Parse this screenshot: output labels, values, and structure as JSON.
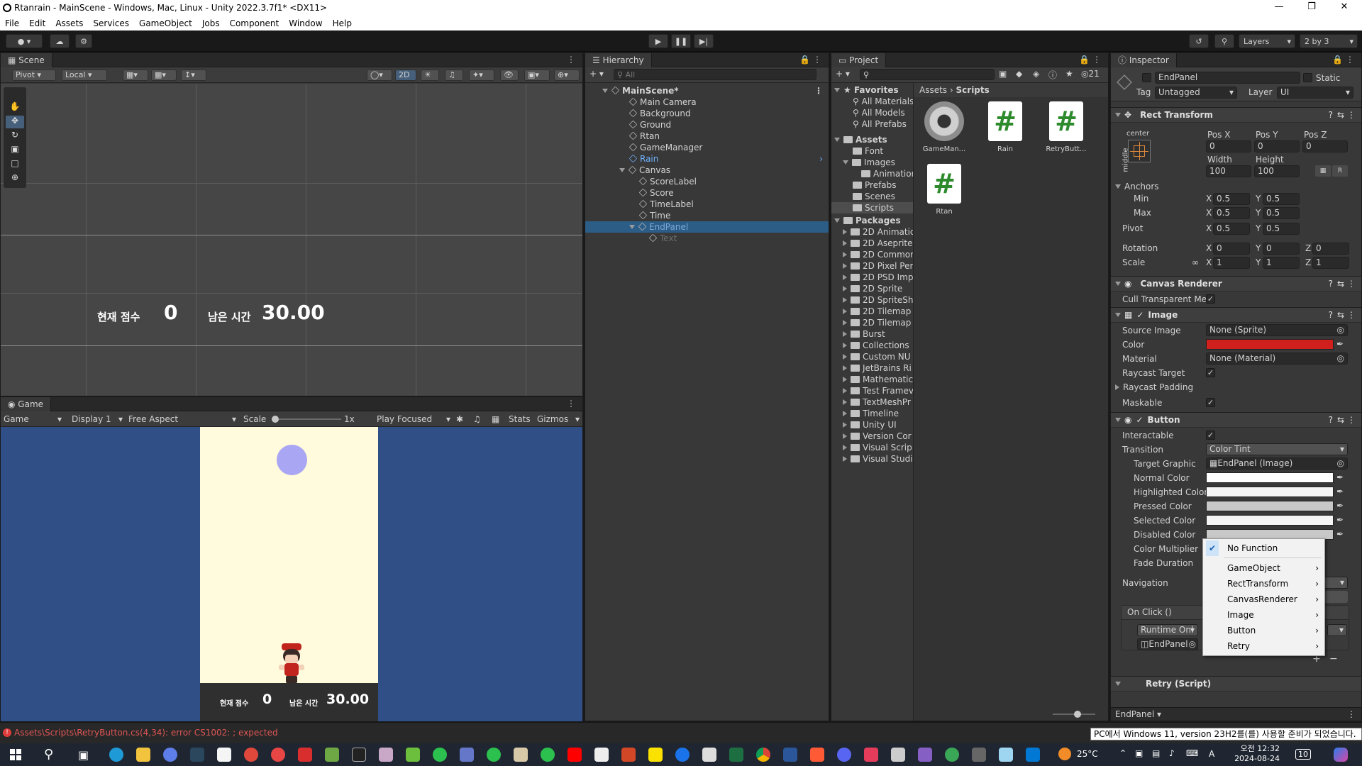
{
  "window": {
    "title": "Rtanrain - MainScene - Windows, Mac, Linux - Unity 2022.3.7f1* <DX11>"
  },
  "menu": [
    "File",
    "Edit",
    "Assets",
    "Services",
    "GameObject",
    "Jobs",
    "Component",
    "Window",
    "Help"
  ],
  "toolbar": {
    "layers_label": "Layers",
    "layout_label": "2 by 3"
  },
  "scene": {
    "tab": "Scene",
    "pivot": "Pivot",
    "local": "Local",
    "mode_2d": "2D",
    "score_label": "현재 점수",
    "score_value": "0",
    "time_label": "남은 시간",
    "time_value": "30.00"
  },
  "game": {
    "tab": "Game",
    "mode": "Game",
    "display": "Display 1",
    "aspect": "Free Aspect",
    "scale_label": "Scale",
    "scale_value": "1x",
    "play_focused": "Play Focused",
    "stats": "Stats",
    "gizmos": "Gizmos",
    "score_label": "현재 점수",
    "score_value": "0",
    "time_label": "남은 시간",
    "time_value": "30.00",
    "colors": {
      "background": "#2f4f86",
      "playfield": "#fffbdc",
      "rain": "#a9a6f4"
    }
  },
  "hierarchy": {
    "tab": "Hierarchy",
    "search_placeholder": "All",
    "items": [
      {
        "label": "MainScene*",
        "depth": 0
      },
      {
        "label": "Main Camera",
        "depth": 1
      },
      {
        "label": "Background",
        "depth": 1
      },
      {
        "label": "Ground",
        "depth": 1
      },
      {
        "label": "Rtan",
        "depth": 1
      },
      {
        "label": "GameManager",
        "depth": 1
      },
      {
        "label": "Rain",
        "depth": 1
      },
      {
        "label": "Canvas",
        "depth": 1
      },
      {
        "label": "ScoreLabel",
        "depth": 2
      },
      {
        "label": "Score",
        "depth": 2
      },
      {
        "label": "TimeLabel",
        "depth": 2
      },
      {
        "label": "Time",
        "depth": 2
      },
      {
        "label": "EndPanel",
        "depth": 2
      },
      {
        "label": "Text",
        "depth": 3
      }
    ]
  },
  "project": {
    "tab": "Project",
    "count": "21",
    "breadcrumb": [
      "Assets",
      "Scripts"
    ],
    "favorites_title": "Favorites",
    "favorites": [
      "All Materials",
      "All Models",
      "All Prefabs"
    ],
    "assets_title": "Assets",
    "assets": [
      "Font",
      "Images",
      "Animation",
      "Prefabs",
      "Scenes",
      "Scripts"
    ],
    "packages_title": "Packages",
    "packages": [
      "2D Animatic",
      "2D Aseprite",
      "2D Commor",
      "2D Pixel Per",
      "2D PSD Imp",
      "2D Sprite",
      "2D SpriteSh",
      "2D Tilemap",
      "2D Tilemap",
      "Burst",
      "Collections",
      "Custom NU",
      "JetBrains Ri",
      "Mathematic",
      "Test Framev",
      "TextMeshPr",
      "Timeline",
      "Unity UI",
      "Version Cor",
      "Visual Scrip",
      "Visual Studi"
    ],
    "files": [
      "GameMan...",
      "Rain",
      "RetryButt...",
      "Rtan"
    ]
  },
  "inspector": {
    "tab": "Inspector",
    "object_name": "EndPanel",
    "static_label": "Static",
    "tag_label": "Tag",
    "tag_value": "Untagged",
    "layer_label": "Layer",
    "layer_value": "UI",
    "rect_transform": {
      "title": "Rect Transform",
      "anchor_h": "center",
      "anchor_v": "middle",
      "posx_label": "Pos X",
      "posy_label": "Pos Y",
      "posz_label": "Pos Z",
      "posx": "0",
      "posy": "0",
      "posz": "0",
      "width_label": "Width",
      "height_label": "Height",
      "width": "100",
      "height": "100",
      "anchors_label": "Anchors",
      "min_label": "Min",
      "max_label": "Max",
      "min_x": "0.5",
      "min_y": "0.5",
      "max_x": "0.5",
      "max_y": "0.5",
      "pivot_label": "Pivot",
      "pivot_x": "0.5",
      "pivot_y": "0.5",
      "rotation_label": "Rotation",
      "rot_x": "0",
      "rot_y": "0",
      "rot_z": "0",
      "scale_label": "Scale",
      "scale_x": "1",
      "scale_y": "1",
      "scale_z": "1"
    },
    "canvas_renderer": {
      "title": "Canvas Renderer",
      "cull_label": "Cull Transparent Mes"
    },
    "image": {
      "title": "Image",
      "source_label": "Source Image",
      "source_value": "None (Sprite)",
      "color_label": "Color",
      "color": "#d0201e",
      "material_label": "Material",
      "material_value": "None (Material)",
      "raycast_label": "Raycast Target",
      "padding_label": "Raycast Padding",
      "maskable_label": "Maskable"
    },
    "button": {
      "title": "Button",
      "interactable_label": "Interactable",
      "transition_label": "Transition",
      "transition_value": "Color Tint",
      "target_label": "Target Graphic",
      "target_value": "EndPanel (Image)",
      "normal_label": "Normal Color",
      "highlighted_label": "Highlighted Color",
      "pressed_label": "Pressed Color",
      "selected_label": "Selected Color",
      "disabled_label": "Disabled Color",
      "multiplier_label": "Color Multiplier",
      "fade_label": "Fade Duration",
      "navigation_label": "Navigation",
      "onclick_label": "On Click ()",
      "runtime_value": "Runtime Onl",
      "object_value": "EndPanel"
    },
    "next_component": "Retry (Script)",
    "footer_label": "EndPanel"
  },
  "dropdown": {
    "items": [
      {
        "label": "No Function",
        "checked": true,
        "submenu": false
      },
      {
        "label": "GameObject",
        "checked": false,
        "submenu": true
      },
      {
        "label": "RectTransform",
        "checked": false,
        "submenu": true
      },
      {
        "label": "CanvasRenderer",
        "checked": false,
        "submenu": true
      },
      {
        "label": "Image",
        "checked": false,
        "submenu": true
      },
      {
        "label": "Button",
        "checked": false,
        "submenu": true
      },
      {
        "label": "Retry",
        "checked": false,
        "submenu": true
      }
    ]
  },
  "statusbar": {
    "error": "Assets\\Scripts\\RetryButton.cs(4,34): error CS1002: ; expected"
  },
  "tooltip": "PC에서 Windows 11, version 23H2를(를) 사용할 준비가 되었습니다.",
  "taskbar": {
    "weather": "25°C",
    "time": "오전 12:32",
    "date": "2024-08-24",
    "ime": "A",
    "badge": "10"
  }
}
